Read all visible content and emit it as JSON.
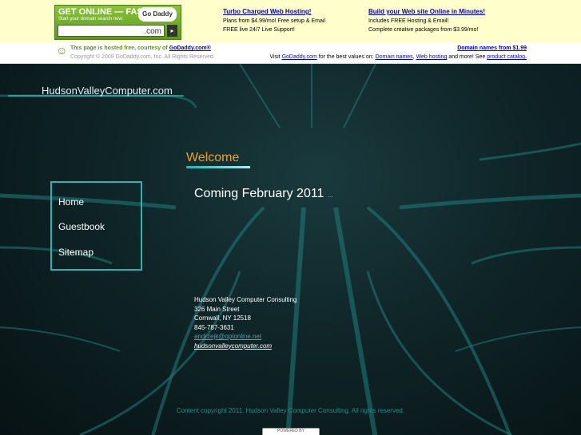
{
  "promo_bar": {
    "godaddy_box": {
      "title": "GET ONLINE — FAST!",
      "subtitle": "Start your domain search now:",
      "logo": "Go Daddy",
      "domain_suffix": ".com",
      "go_glyph": "▸"
    },
    "promo1": {
      "title": "Turbo Charged Web Hosting!",
      "line1": "Plans from $4.99/mo! Free setup & Email",
      "line2": "FREE live 24/7 Live Support!"
    },
    "promo2": {
      "title": "Build your Web site Online in Minutes!",
      "line1": "Includes FREE Hosting & Email!",
      "line2": "Complete creative packages from $3.99/mo!"
    }
  },
  "host_bar": {
    "hosted_text": "This page is hosted free, courtesy of",
    "hosted_link": "GoDaddy.com®",
    "copyright": "Copyright © 2009 GoDaddy.com, Inc. All Rights Reserved.",
    "domain_names_link": "Domain names from $1.99",
    "visit_prefix": "Visit",
    "visit_link": "GoDaddy.com",
    "visit_middle": "for the best values on:",
    "link_domain_names": "Domain names",
    "link_web_hosting": "Web hosting",
    "visit_more": "and more! See",
    "link_product_catalog": "product catalog."
  },
  "site": {
    "title": "HudsonValleyComputer.com",
    "welcome": "Welcome",
    "nav": [
      "Home",
      "Guestbook",
      "Sitemap"
    ],
    "heading": "Coming February 2011",
    "heading_suffix": "...",
    "address": {
      "company": "Hudson Valley Computer Consulting",
      "street": "326 Main Street",
      "city": "Cornwall, NY 12518",
      "phone": "845-787-3631",
      "email": "andrzejk@optonline.net",
      "website": "hudsonvalleycomputer.com"
    },
    "footer": "Content copyright 2011. Hudson Valley Computer Consulting. All rights reserved.",
    "badge": "POWERED BY"
  },
  "colors": {
    "accent_orange": "#f0a020",
    "accent_teal": "#2fb2b0",
    "promo_bg": "#ffffcc"
  }
}
